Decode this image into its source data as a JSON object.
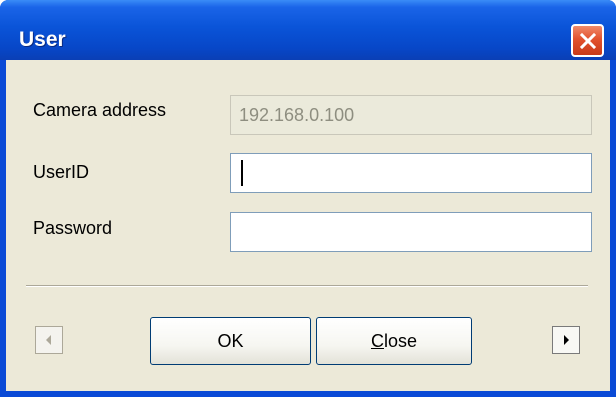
{
  "window": {
    "title": "User"
  },
  "form": {
    "camera_address_label": "Camera address",
    "camera_address_value": "192.168.0.100",
    "userid_label": "UserID",
    "userid_value": "",
    "password_label": "Password",
    "password_value": ""
  },
  "buttons": {
    "ok_label": "OK",
    "close_label_first": "C",
    "close_label_rest": "lose",
    "prev_icon": "triangle-left-icon",
    "next_icon": "triangle-right-icon"
  },
  "colors": {
    "titlebar": "#0a54d8",
    "client_bg": "#ece9d8",
    "close_button": "#e2522e"
  }
}
